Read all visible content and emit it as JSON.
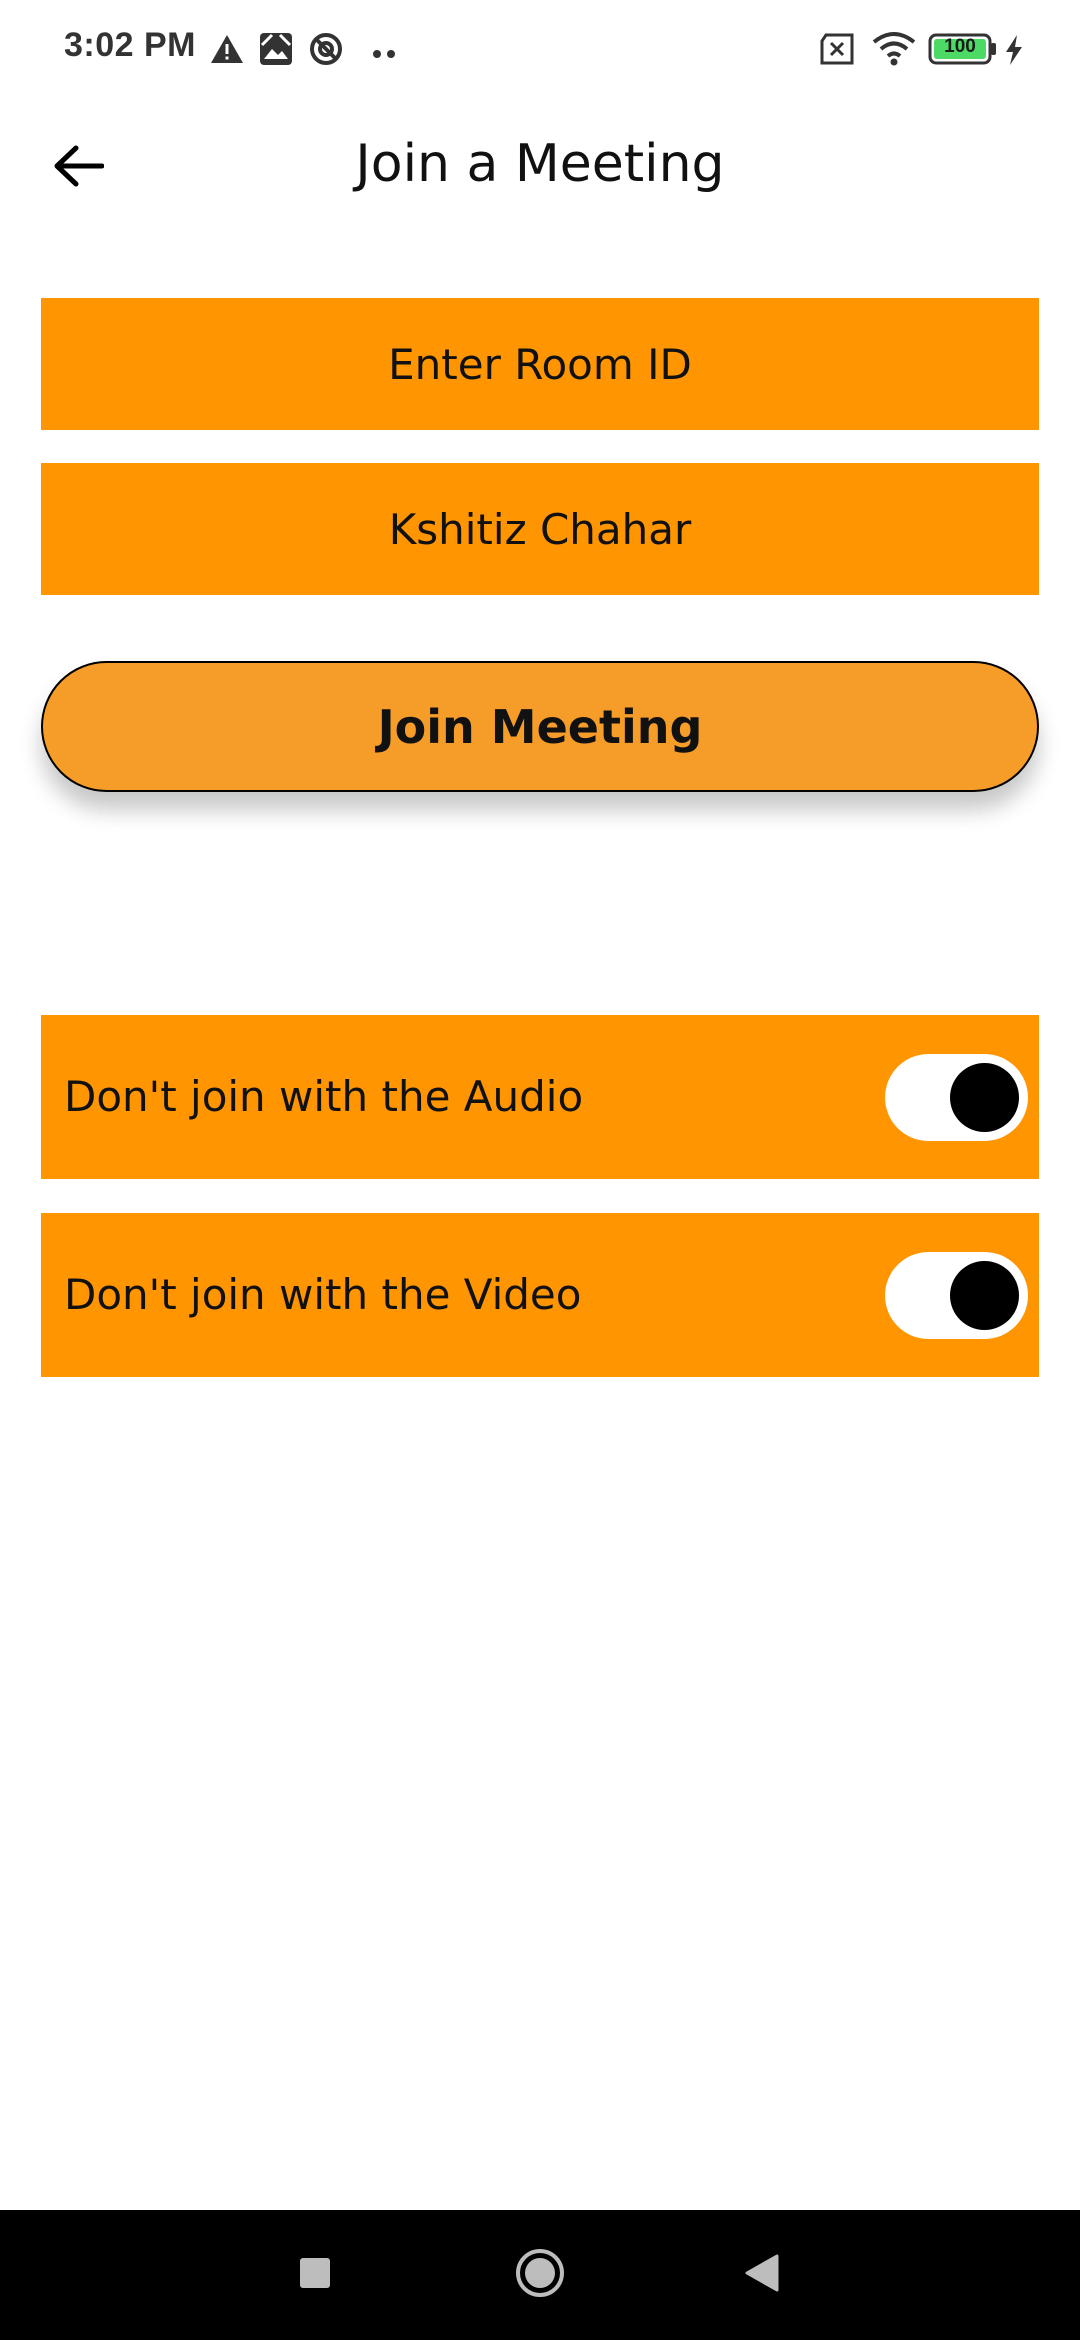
{
  "status_bar": {
    "time": "3:02 PM",
    "left_icons": [
      "warning-icon",
      "photo-icon",
      "vpn-icon",
      "more-dots-icon"
    ],
    "right_icons": [
      "no-sim-icon",
      "wifi-icon",
      "battery-icon",
      "charging-icon"
    ],
    "battery_level": "100",
    "battery_color": "#4cd964"
  },
  "app_bar": {
    "back_icon": "arrow-left-icon",
    "title": "Join a Meeting"
  },
  "form": {
    "room_id": {
      "placeholder": "Enter Room ID",
      "value": ""
    },
    "name": {
      "placeholder": "",
      "value": "Kshitiz Chahar"
    },
    "join_button_label": "Join Meeting"
  },
  "options": [
    {
      "label": "Don't join with the Audio",
      "enabled": true
    },
    {
      "label": "Don't join with the Video",
      "enabled": true
    }
  ],
  "colors": {
    "accent": "#ff9500",
    "button": "#f59c29",
    "switch_track": "#ffffff",
    "switch_thumb": "#000000",
    "nav_bar": "#000000"
  },
  "nav_bar": {
    "icons": [
      "recents-square-icon",
      "home-circle-icon",
      "back-triangle-icon"
    ]
  }
}
